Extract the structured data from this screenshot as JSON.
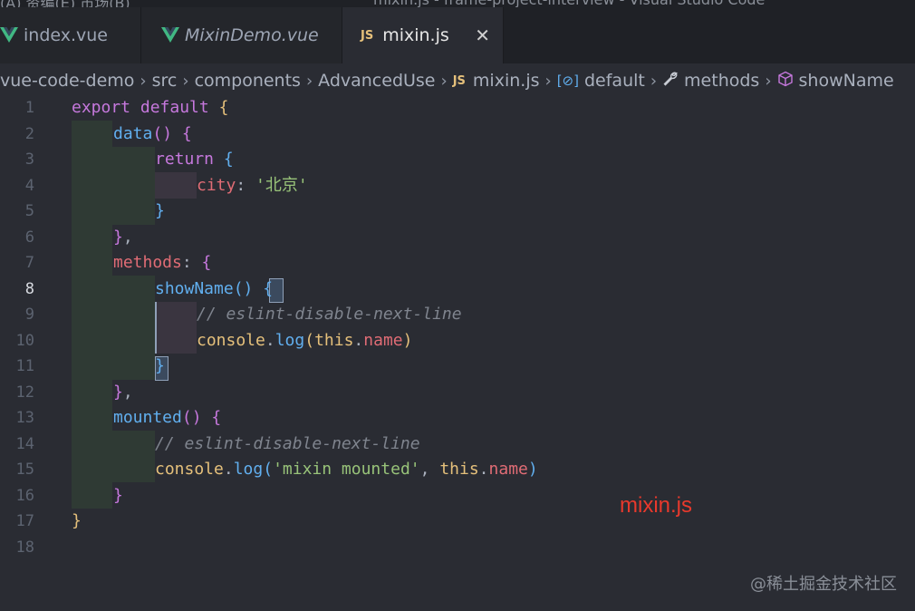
{
  "window_title": "mixin.js - frame-project-interview - Visual Studio Code",
  "menu_left": "(A)  资编(E)   市场(B)",
  "tabs": [
    {
      "label": "index.vue",
      "icon": "vue-icon"
    },
    {
      "label": "MixinDemo.vue",
      "icon": "vue-icon"
    },
    {
      "label": "mixin.js",
      "icon": "js-icon",
      "active": true
    }
  ],
  "js_badge": "JS",
  "close_glyph": "✕",
  "breadcrumb": [
    "vue-code-demo",
    "src",
    "components",
    "AdvancedUse",
    "mixin.js",
    "default",
    "methods",
    "showName"
  ],
  "line_numbers": [
    "1",
    "2",
    "3",
    "4",
    "5",
    "6",
    "7",
    "8",
    "9",
    "10",
    "11",
    "12",
    "13",
    "14",
    "15",
    "16",
    "17",
    "18"
  ],
  "code": {
    "l1a": "export",
    "l1b": "default",
    "l1c": "{",
    "l2a": "data",
    "l2b": "()",
    "l2c": "{",
    "l3a": "return",
    "l3b": "{",
    "l4a": "city",
    "l4b": ": ",
    "l4c": "'北京'",
    "l5a": "}",
    "l6a": "}",
    "l6b": ",",
    "l7a": "methods",
    "l7b": ": ",
    "l7c": "{",
    "l8a": "showName",
    "l8b": "()",
    "l8c": "{",
    "l9a": "// eslint-disable-next-line",
    "l10a": "console",
    "l10b": ".",
    "l10c": "log",
    "l10d": "(",
    "l10e": "this",
    "l10f": ".",
    "l10g": "name",
    "l10h": ")",
    "l11a": "}",
    "l12a": "}",
    "l12b": ",",
    "l13a": "mounted",
    "l13b": "()",
    "l13c": "{",
    "l14a": "// eslint-disable-next-line",
    "l15a": "console",
    "l15b": ".",
    "l15c": "log",
    "l15d": "(",
    "l15e": "'mixin mounted'",
    "l15f": ", ",
    "l15g": "this",
    "l15h": ".",
    "l15i": "name",
    "l15j": ")",
    "l16a": "}",
    "l17a": "}"
  },
  "annotation": "mixin.js",
  "watermark": "@稀土掘金技术社区",
  "colors": {
    "keyword": "#c678dd",
    "function": "#61afef",
    "property": "#e06c75",
    "string": "#98c379",
    "annotation": "#e8392c"
  }
}
